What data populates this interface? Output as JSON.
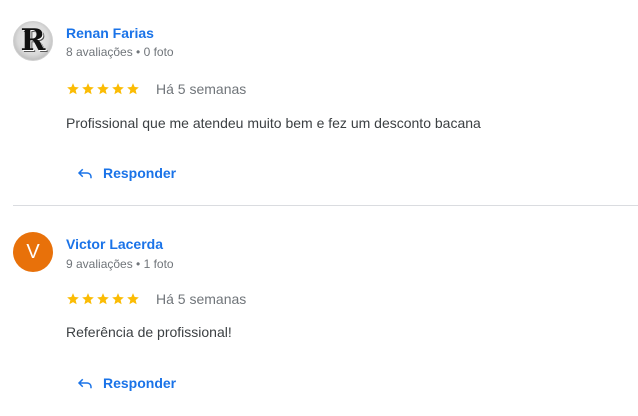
{
  "reviews": [
    {
      "name": "Renan Farias",
      "avatar_letter": "R",
      "meta": "8 avaliações • 0 foto",
      "stars": 5,
      "time": "Há 5 semanas",
      "text": "Profissional que me atendeu muito bem e fez um desconto bacana",
      "reply_label": "Responder"
    },
    {
      "name": "Victor Lacerda",
      "avatar_letter": "V",
      "meta": "9 avaliações • 1 foto",
      "stars": 5,
      "time": "Há 5 semanas",
      "text": "Referência de profissional!",
      "reply_label": "Responder"
    }
  ],
  "colors": {
    "link": "#1a73e8",
    "star": "#fbbc04",
    "avatar_orange": "#e8710a",
    "muted": "#70757a"
  },
  "icons": {
    "star": "star-icon",
    "reply": "reply-arrow-icon"
  }
}
